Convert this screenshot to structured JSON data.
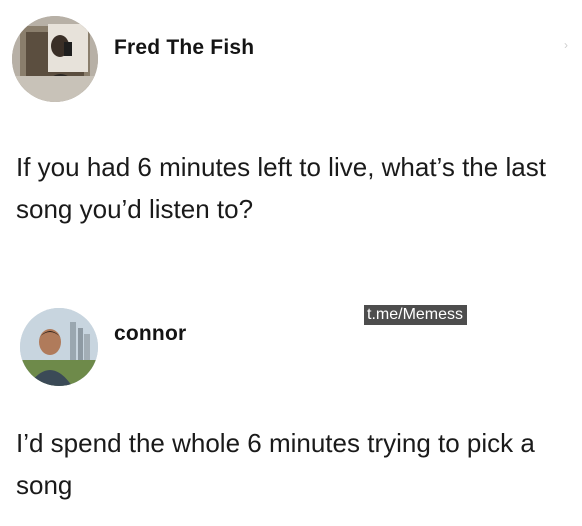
{
  "posts": [
    {
      "author": "Fred The Fish",
      "text": "If you had 6 minutes left to live, what’s the last song you’d listen to?"
    },
    {
      "author": "connor",
      "text": "I’d spend the whole 6 minutes trying to pick a song"
    }
  ],
  "watermark": "t.me/Memess",
  "icons": {
    "more": "chevron-right-icon"
  }
}
